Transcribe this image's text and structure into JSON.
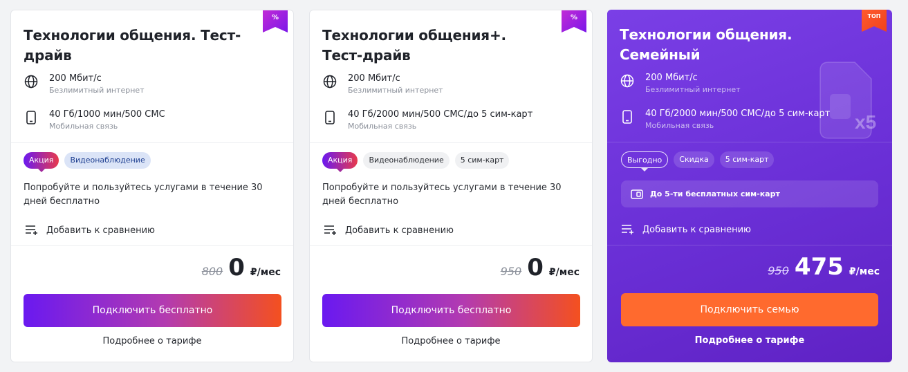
{
  "cards": [
    {
      "ribbon": "%",
      "title": "Технологии общения. Тест-драйв",
      "features": [
        {
          "icon": "globe-icon",
          "main": "200 Мбит/с",
          "sub": "Безлимитный интернет"
        },
        {
          "icon": "phone-icon",
          "main": "40 Гб/1000 мин/500 СМС",
          "sub": "Мобильная связь"
        }
      ],
      "tags": [
        "Акция",
        "Видеонаблюдение"
      ],
      "description": "Попробуйте и пользуйтесь услугами в течение 30 дней бесплатно",
      "compare": "Добавить к сравнению",
      "price_old": "800",
      "price_new": "0",
      "price_unit": "₽/мес",
      "button": "Подключить бесплатно",
      "more": "Подробнее о тарифе"
    },
    {
      "ribbon": "%",
      "title": "Технологии общения+. Тест-драйв",
      "features": [
        {
          "icon": "globe-icon",
          "main": "200 Мбит/с",
          "sub": "Безлимитный интернет"
        },
        {
          "icon": "phone-icon",
          "main": "40 Гб/2000 мин/500 СМС/до 5 сим-карт",
          "sub": "Мобильная связь"
        }
      ],
      "tags": [
        "Акция",
        "Видеонаблюдение",
        "5 сим-карт"
      ],
      "description": "Попробуйте и пользуйтесь услугами в течение 30 дней бесплатно",
      "compare": "Добавить к сравнению",
      "price_old": "950",
      "price_new": "0",
      "price_unit": "₽/мес",
      "button": "Подключить бесплатно",
      "more": "Подробнее о тарифе"
    },
    {
      "ribbon": "ТОП",
      "title": "Технологии общения. Семейный",
      "badge_multiplier": "x5",
      "features": [
        {
          "icon": "globe-icon",
          "main": "200 Мбит/с",
          "sub": "Безлимитный интернет"
        },
        {
          "icon": "phone-icon",
          "main": "40 Гб/2000 мин/500 СМС/до 5 сим-карт",
          "sub": "Мобильная связь"
        }
      ],
      "tags": [
        "Выгодно",
        "Скидка",
        "5 сим-карт"
      ],
      "sim_offer": "До 5-ти бесплатных сим-карт",
      "compare": "Добавить к сравнению",
      "price_old": "950",
      "price_new": "475",
      "price_unit": "₽/мес",
      "button": "Подключить семью",
      "more": "Подробнее о тарифе"
    }
  ],
  "colors": {
    "accent_gradient_start": "#6a19f0",
    "accent_gradient_end": "#f4501f",
    "family_card_bg": "#6a2fd6",
    "family_button": "#ff6a2e"
  }
}
